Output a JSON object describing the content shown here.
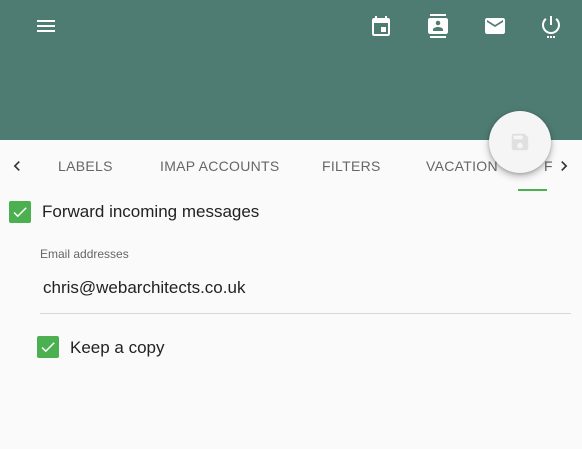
{
  "header": {
    "icons": [
      "menu-icon",
      "calendar-icon",
      "contacts-icon",
      "mail-icon",
      "power-icon"
    ]
  },
  "fab": {
    "icon": "save-icon"
  },
  "tabs": {
    "items": [
      {
        "label": "LABELS"
      },
      {
        "label": "IMAP ACCOUNTS"
      },
      {
        "label": "FILTERS"
      },
      {
        "label": "VACATION"
      },
      {
        "label": "F"
      }
    ],
    "active_index": 4,
    "accent_color": "#4caf50"
  },
  "forward": {
    "checkbox_label": "Forward incoming messages",
    "checked": true
  },
  "email_field": {
    "label": "Email addresses",
    "value": "chris@webarchitects.co.uk"
  },
  "keep_copy": {
    "checkbox_label": "Keep a copy",
    "checked": true
  },
  "colors": {
    "app_bar": "#4f7c72",
    "checkbox": "#4caf50",
    "background": "#fafafa"
  }
}
